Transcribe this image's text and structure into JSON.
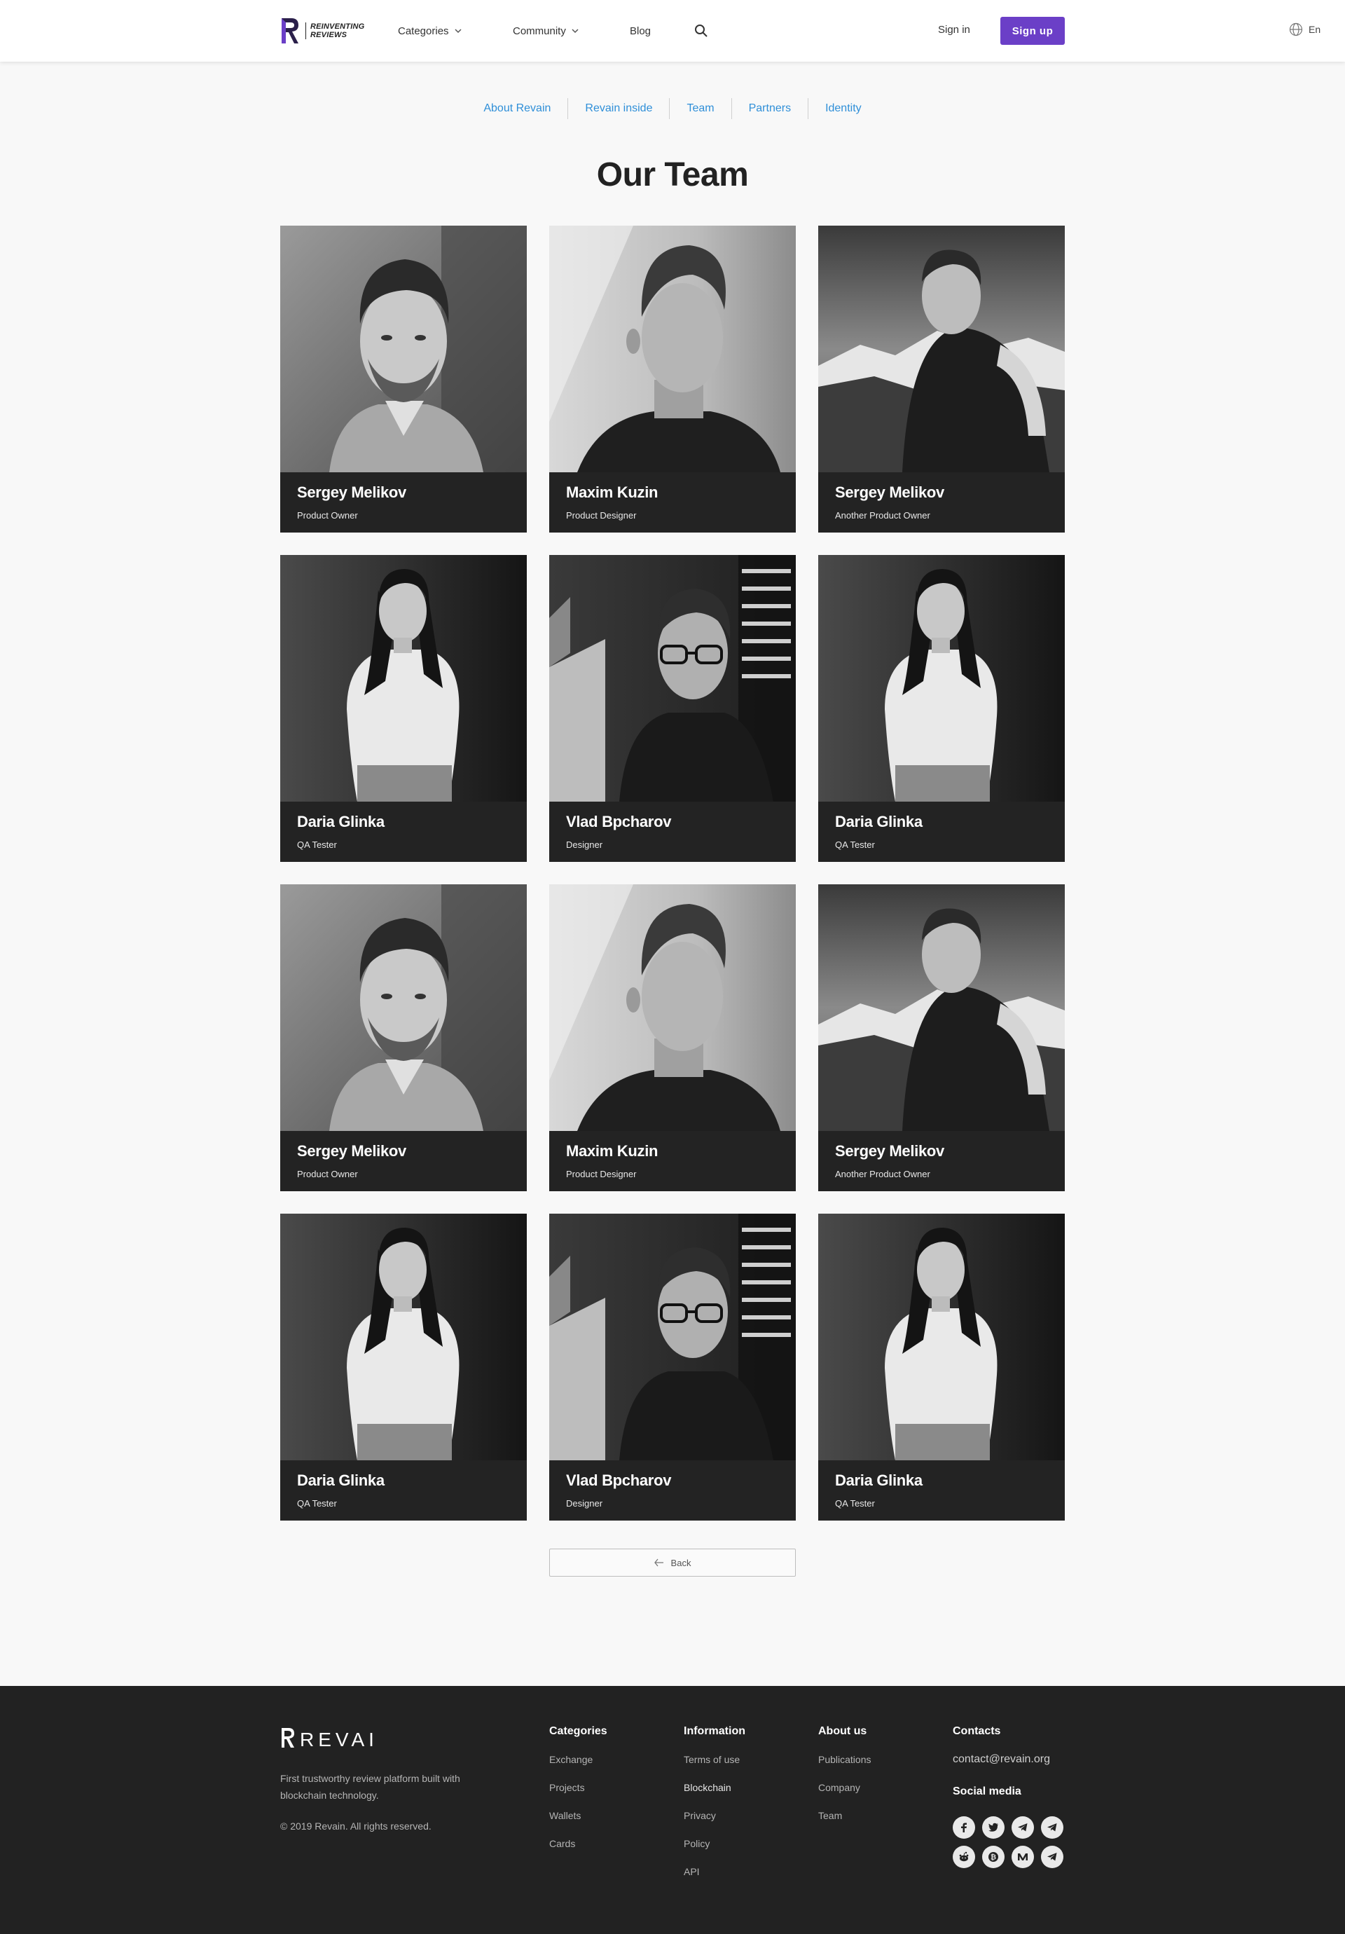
{
  "header": {
    "logo_line1": "REINVENTING",
    "logo_line2": "REVIEWS",
    "nav": {
      "categories": "Categories",
      "community": "Community",
      "blog": "Blog"
    },
    "signin": "Sign in",
    "signup": "Sign  up",
    "language": "En",
    "accent_color": "#6b3fc7"
  },
  "subnav": [
    "About Revain",
    "Revain inside",
    "Team",
    "Partners",
    "Identity"
  ],
  "page_title": "Our Team",
  "team": [
    {
      "name": "Sergey Melikov",
      "role": "Product Owner",
      "photo": "bearded-man-portrait"
    },
    {
      "name": "Maxim Kuzin",
      "role": "Product Designer",
      "photo": "man-side-profile"
    },
    {
      "name": "Sergey Melikov",
      "role": "Another Product Owner",
      "photo": "man-mountain-backpack"
    },
    {
      "name": "Daria Glinka",
      "role": "QA Tester",
      "photo": "woman-white-tshirt"
    },
    {
      "name": "Vlad Bpcharov",
      "role": "Designer",
      "photo": "man-glasses-working"
    },
    {
      "name": "Daria Glinka",
      "role": "QA Tester",
      "photo": "woman-white-tshirt"
    },
    {
      "name": "Sergey Melikov",
      "role": "Product Owner",
      "photo": "bearded-man-portrait"
    },
    {
      "name": "Maxim Kuzin",
      "role": "Product Designer",
      "photo": "man-side-profile"
    },
    {
      "name": "Sergey Melikov",
      "role": "Another Product Owner",
      "photo": "man-mountain-backpack"
    },
    {
      "name": "Daria Glinka",
      "role": "QA Tester",
      "photo": "woman-white-tshirt"
    },
    {
      "name": "Vlad Bpcharov",
      "role": "Designer",
      "photo": "man-glasses-working"
    },
    {
      "name": "Daria Glinka",
      "role": "QA Tester",
      "photo": "woman-white-tshirt"
    }
  ],
  "back_label": "Back",
  "footer": {
    "brand": "REVAIN",
    "description": "First trustworthy review platform built with blockchain technology.",
    "copyright": "© 2019 Revain. All rights reserved.",
    "columns": [
      {
        "heading": "Categories",
        "links": [
          "Exchange",
          "Projects",
          "Wallets",
          "Cards"
        ]
      },
      {
        "heading": "Information",
        "links": [
          "Terms of use",
          "Blockchain",
          "Privacy",
          "Policy",
          "API"
        ]
      },
      {
        "heading": "About us",
        "links": [
          "Publications",
          "Company",
          "Team"
        ]
      }
    ],
    "contacts_heading": "Contacts",
    "email": "contact@revain.org",
    "social_heading": "Social media",
    "social": [
      "facebook-icon",
      "twitter-icon",
      "telegram-icon",
      "telegram-icon",
      "reddit-icon",
      "bitcoin-icon",
      "medium-icon",
      "telegram-icon"
    ]
  }
}
